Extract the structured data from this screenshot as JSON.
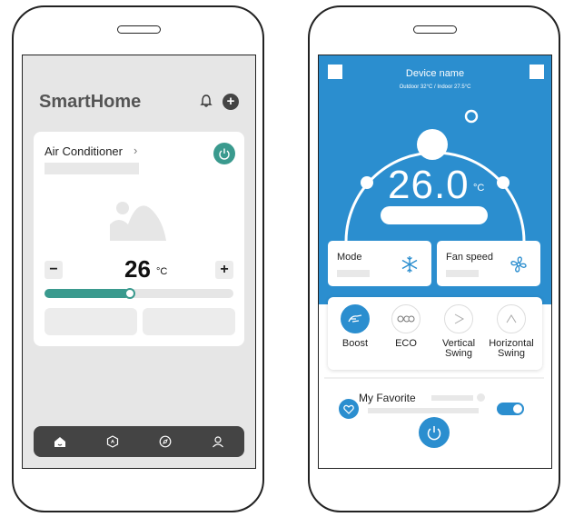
{
  "left": {
    "app_title": "SmartHome",
    "card": {
      "title": "Air Conditioner",
      "chevron": "›",
      "temperature": "26",
      "unit": "°C",
      "minus": "−",
      "plus": "+",
      "slider_value": 0.45
    },
    "header_plus": "+",
    "nav": [
      "home-icon",
      "scenes-icon",
      "discover-icon",
      "profile-icon"
    ],
    "accent": "#3a9a8e"
  },
  "right": {
    "device_name": "Device name",
    "device_temps": "Outdoor 32°C / Indoor 27.5°C",
    "temperature": "26.0",
    "unit": "°C",
    "mode_label": "Mode",
    "fan_label": "Fan speed",
    "functions": [
      {
        "label": "Boost",
        "icon": "boost-icon",
        "active": true
      },
      {
        "label": "ECO",
        "icon": "eco-icon",
        "active": false
      },
      {
        "label": "Vertical Swing",
        "icon": "vertical-swing-icon",
        "active": false
      },
      {
        "label": "Horizontal Swing",
        "icon": "horizontal-swing-icon",
        "active": false
      }
    ],
    "favorite_label": "My Favorite",
    "favorite_toggle": true,
    "accent": "#2b8ecf"
  }
}
